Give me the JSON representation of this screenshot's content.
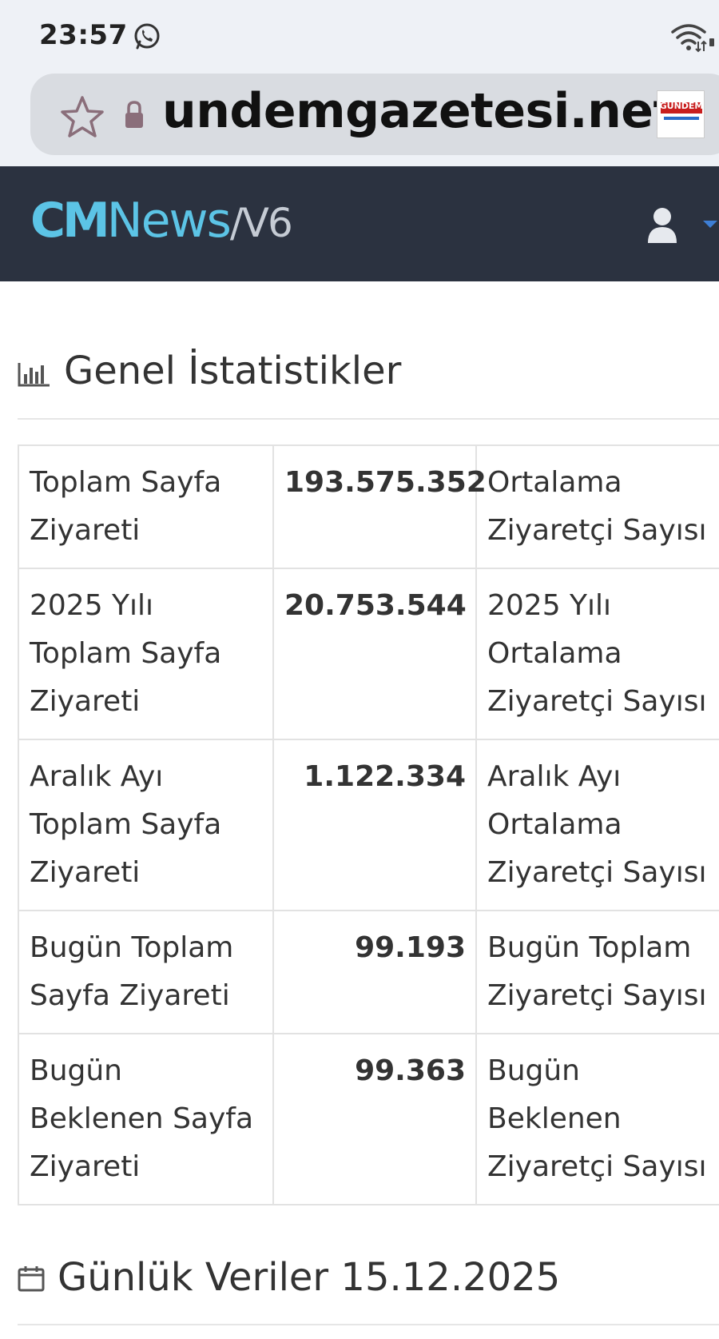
{
  "status_bar": {
    "time": "23:57",
    "icons": [
      "whatsapp-icon",
      "wifi-icon",
      "signal-icon"
    ]
  },
  "browser": {
    "url": "undemgazetesi.net",
    "favicon_text": "GÜNDEM",
    "icons": [
      "star-icon",
      "lock-icon"
    ]
  },
  "app": {
    "logo_cm": "CM",
    "logo_news": "News",
    "logo_version": "/V6",
    "accent_color": "#5cc4e6",
    "header_color": "#2b3240",
    "icons": [
      "user-icon",
      "caret-down-icon"
    ]
  },
  "sections": {
    "general_title": "Genel İstatistikler",
    "daily_title": "Günlük Veriler 15.12.2025"
  },
  "stats": {
    "rows": [
      {
        "label": "Toplam Sayfa Ziyareti",
        "value": "193.575.352",
        "label2": "Ortalama Ziyaretçi Sayısı"
      },
      {
        "label": "2025 Yılı Toplam Sayfa Ziyareti",
        "value": "20.753.544",
        "label2": "2025 Yılı Ortalama Ziyaretçi Sayısı"
      },
      {
        "label": "Aralık Ayı Toplam Sayfa Ziyareti",
        "value": "1.122.334",
        "label2": "Aralık Ayı Ortalama Ziyaretçi Sayısı"
      },
      {
        "label": "Bugün Toplam Sayfa Ziyareti",
        "value": "99.193",
        "label2": "Bugün Toplam Ziyaretçi Sayısı"
      },
      {
        "label": "Bugün Beklenen Sayfa Ziyareti",
        "value": "99.363",
        "label2": "Bugün Beklenen Ziyaretçi Sayısı"
      }
    ]
  }
}
